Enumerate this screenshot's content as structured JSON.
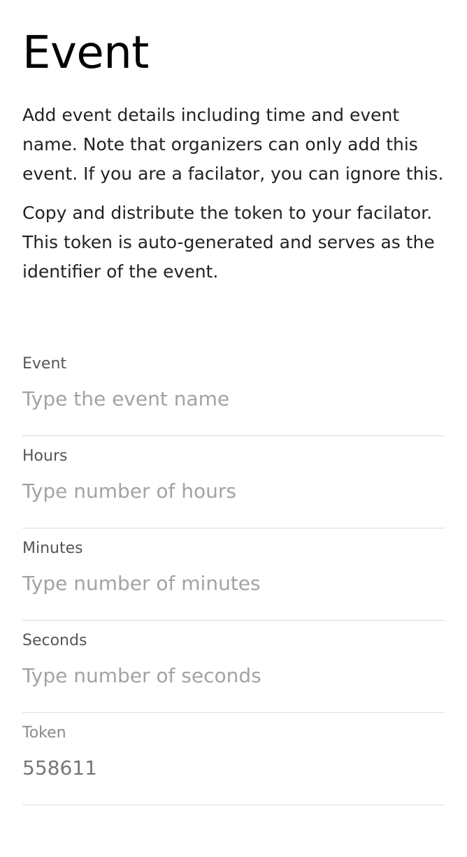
{
  "header": {
    "title": "Event"
  },
  "intro": {
    "paragraph_1": "Add event details including time and event name. Note that organizers can only add this event. If you are a facilator, you can ignore this.",
    "paragraph_2": "Copy and distribute the token to your facilator. This token is auto-generated and serves as the identifier of the event."
  },
  "form": {
    "event": {
      "label": "Event",
      "placeholder": "Type the event name",
      "value": ""
    },
    "hours": {
      "label": "Hours",
      "placeholder": "Type number of hours",
      "value": ""
    },
    "minutes": {
      "label": "Minutes",
      "placeholder": "Type number of minutes",
      "value": ""
    },
    "seconds": {
      "label": "Seconds",
      "placeholder": "Type number of seconds",
      "value": ""
    },
    "token": {
      "label": "Token",
      "value": "558611"
    }
  },
  "colors": {
    "text": "#222222",
    "label": "#555555",
    "placeholder": "#a3a3a3",
    "divider": "#dcdcdc"
  }
}
